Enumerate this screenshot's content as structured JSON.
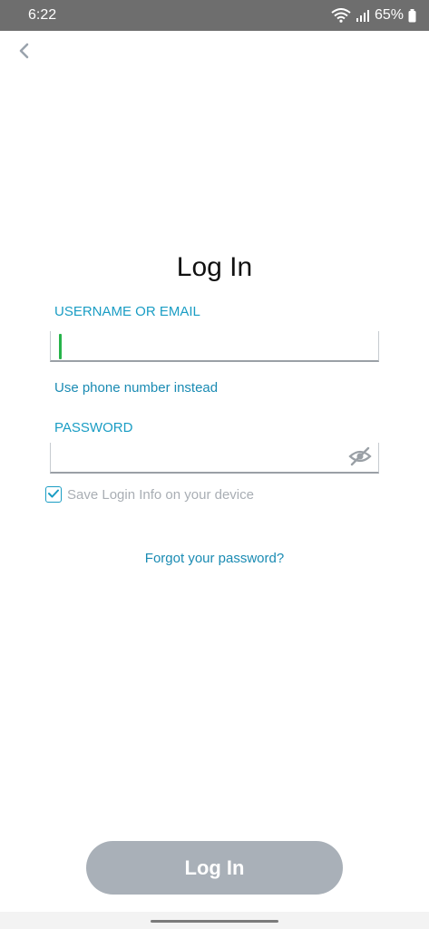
{
  "status_bar": {
    "time": "6:22",
    "battery": "65%"
  },
  "login": {
    "title": "Log In",
    "username_label": "USERNAME OR EMAIL",
    "username_value": "",
    "phone_link": "Use phone number instead",
    "password_label": "PASSWORD",
    "password_value": "",
    "save_login_label": "Save Login Info on your device",
    "save_login_checked": true,
    "forgot_link": "Forgot your password?",
    "login_button": "Log In"
  },
  "colors": {
    "accent": "#1a9dc4",
    "cursor": "#27b34a",
    "button_disabled": "#a9b0b8"
  }
}
